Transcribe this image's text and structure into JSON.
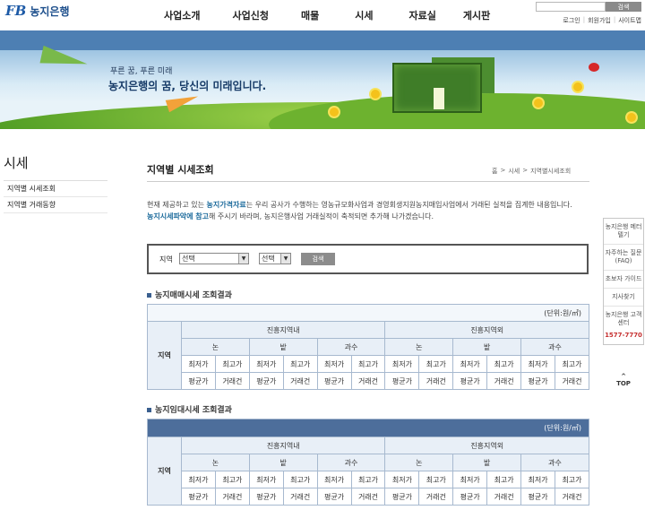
{
  "header": {
    "logo_mark": "FB",
    "logo_text": "농지은행",
    "nav": [
      "사업소개",
      "사업신청",
      "매물",
      "시세",
      "자료실",
      "게시판"
    ],
    "search_button": "검색",
    "util_links": [
      "로그인",
      "회원가입",
      "사이트맵"
    ]
  },
  "banner": {
    "slogan_small": "푸른 꿈, 푸른 미래",
    "slogan_big": "농지은행의 꿈, 당신의 미래입니다."
  },
  "sidebar": {
    "title": "시세",
    "items": [
      "지역별 시세조회",
      "지역별 거래동향"
    ]
  },
  "content": {
    "title": "지역별 시세조회",
    "breadcrumb": [
      "홈",
      "시세",
      "지역별시세조회"
    ],
    "intro": {
      "p1a": "현재 제공하고 있는 ",
      "p1b": "농지가격자료",
      "p1c": "는 우리 공사가 수행하는 영농규모화사업과 경영회생지원농지매입사업에서 거래된 실적을 집계한 내용입니다.",
      "p2a": "농지시세파악에 참고",
      "p2b": "해 주시기 바라며, 농지은행사업 거래실적이 축적되면 추가해 나가겠습니다."
    },
    "search": {
      "label": "지역",
      "select1": "선택",
      "select2": "선택",
      "button": "검색"
    },
    "section1": {
      "title": "농지매매시세 조회결과",
      "unit": "(단위:원/㎡)"
    },
    "section2": {
      "title": "농지임대시세 조회결과",
      "unit": "(단위:원/㎡)"
    },
    "table": {
      "region": "지역",
      "zones": [
        "진흥지역내",
        "진흥지역외"
      ],
      "land_types": [
        "논",
        "밭",
        "과수"
      ],
      "min": "최저가",
      "max": "최고가",
      "avg": "평균가",
      "deals": "거래건"
    }
  },
  "quick_menu": {
    "items": [
      "농지은행 메터텔기",
      "자주하는 질문(FAQ)",
      "초보자 가이드",
      "지사찾기",
      "농지은행 고객센터"
    ],
    "phone": "1577-7770",
    "top": "TOP"
  }
}
